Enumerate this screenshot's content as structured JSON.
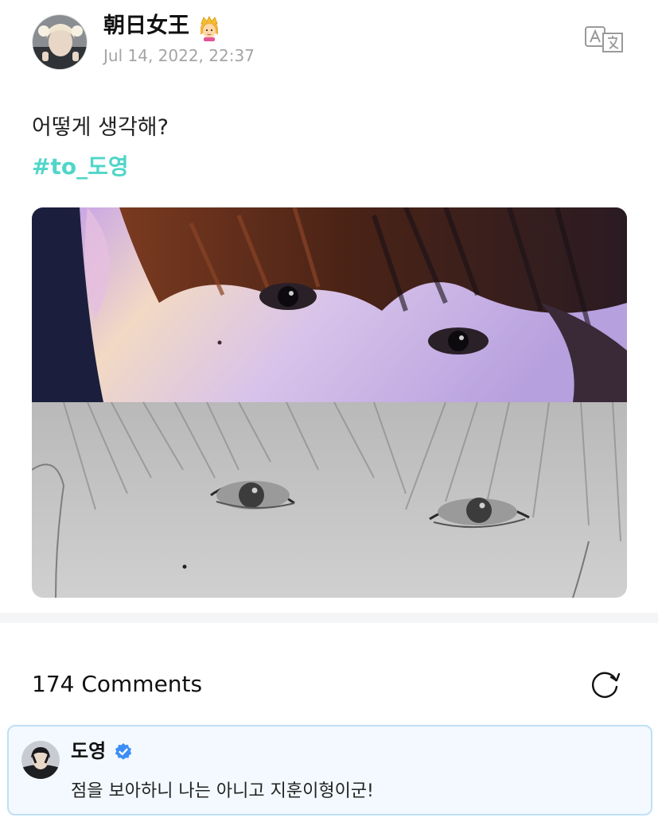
{
  "post": {
    "author": "朝日女王",
    "author_badge_icon": "princess-crown-icon",
    "date": "Jul 14, 2022, 22:37",
    "text": "어떻게 생각해?",
    "hashtag": "#to_도영",
    "translate_icon": "translate-icon",
    "hashtag_color": "#4fd6c8"
  },
  "comments": {
    "count_label": "174 Comments",
    "refresh_icon": "refresh-icon"
  },
  "pinned_comment": {
    "author": "도영",
    "verified_icon": "verified-badge-icon",
    "text": "점을 보아하니 나는 아니고 지훈이형이군!",
    "border_color": "#bfe0f6",
    "background_color": "#f3f9fe"
  }
}
